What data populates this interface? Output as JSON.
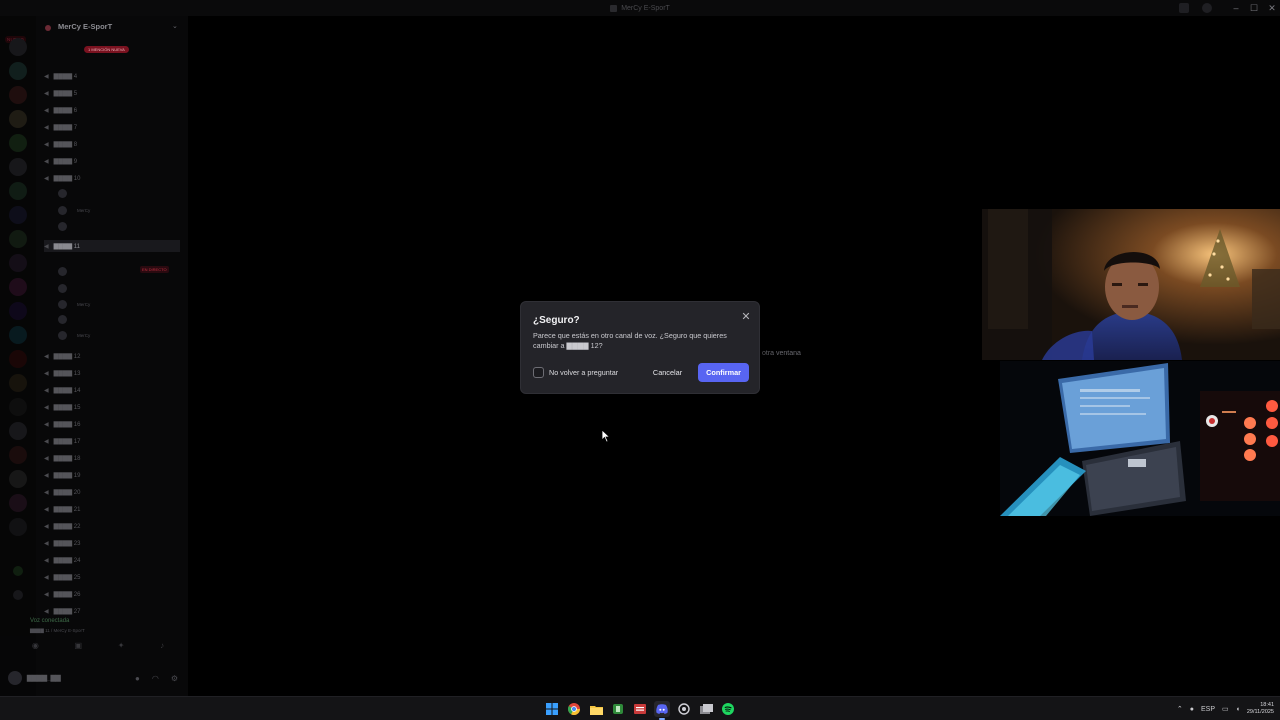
{
  "window": {
    "title": "MerCy E-SporT",
    "controls": {
      "minimize": "–",
      "maximize": "☐",
      "close": "✕"
    }
  },
  "server_rail": {
    "new_label": "NUEVO",
    "badges": [
      "",
      "",
      "",
      "",
      "",
      "",
      "",
      "",
      "",
      "",
      "",
      "",
      "",
      ""
    ]
  },
  "sidebar": {
    "server_name": "MerCy E-SporT",
    "pill": "1 MENCIÓN NUEVA",
    "channels": [
      {
        "label": "▇▇▇▇ 4"
      },
      {
        "label": "▇▇▇▇ 5"
      },
      {
        "label": "▇▇▇▇ 6"
      },
      {
        "label": "▇▇▇▇ 7"
      },
      {
        "label": "▇▇▇▇ 8"
      },
      {
        "label": "▇▇▇▇ 9"
      },
      {
        "label": "▇▇▇▇ 10"
      },
      {
        "label": "▇▇▇▇ 11"
      },
      {
        "label": "▇▇▇▇ 12"
      },
      {
        "label": "▇▇▇▇ 13"
      },
      {
        "label": "▇▇▇▇ 14"
      },
      {
        "label": "▇▇▇▇ 15"
      },
      {
        "label": "▇▇▇▇ 16"
      },
      {
        "label": "▇▇▇▇ 17"
      },
      {
        "label": "▇▇▇▇ 18"
      },
      {
        "label": "▇▇▇▇ 19"
      },
      {
        "label": "▇▇▇▇ 20"
      },
      {
        "label": "▇▇▇▇ 21"
      },
      {
        "label": "▇▇▇▇ 22"
      },
      {
        "label": "▇▇▇▇ 23"
      },
      {
        "label": "▇▇▇▇ 24"
      },
      {
        "label": "▇▇▇▇ 25"
      },
      {
        "label": "▇▇▇▇ 26"
      },
      {
        "label": "▇▇▇▇ 27"
      }
    ],
    "members": [
      {
        "name": "",
        "tag": ""
      },
      {
        "name": "",
        "tag": "MerCy"
      },
      {
        "name": "",
        "tag": ""
      },
      {
        "name": "",
        "tag": ""
      },
      {
        "name": "",
        "tag": ""
      },
      {
        "name": "",
        "tag": "MerCy"
      },
      {
        "name": "",
        "tag": ""
      },
      {
        "name": "",
        "tag": "MerCy"
      }
    ],
    "live_label": "EN DIRECTO",
    "voice_status": "Voz conectada",
    "voice_channel": "▇▇▇▇ 11 / MerCy E-SporT",
    "user": {
      "name": "▇▇▇▇_▇▇",
      "status": ""
    }
  },
  "background_text": "otra ventana",
  "modal": {
    "title": "¿Seguro?",
    "body": "Parece que estás en otro canal de voz. ¿Seguro que quieres cambiar a ▇▇▇▇ 12?",
    "checkbox_label": "No volver a preguntar",
    "cancel_label": "Cancelar",
    "confirm_label": "Confirmar",
    "accent": "#5865f2"
  },
  "taskbar": {
    "apps": [
      "windows-start",
      "chrome",
      "file-explorer",
      "app-green",
      "app-news",
      "discord",
      "app-circle",
      "app-window",
      "spotify"
    ],
    "tray": {
      "language": "ESP",
      "time": "18:41",
      "date": "29/11/2025"
    }
  }
}
